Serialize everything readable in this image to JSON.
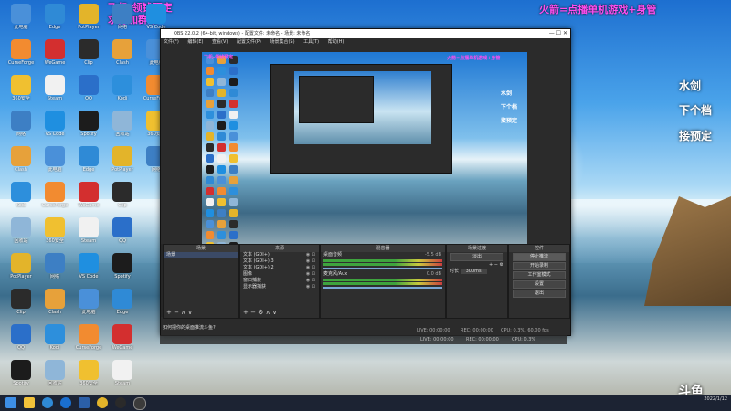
{
  "overlay": {
    "left_line1": "飞机-领钱预定",
    "left_line2": "求打加群账",
    "right": "火箭=点播单机游戏+身管"
  },
  "right_labels": [
    "水剑",
    "下个档",
    "接预定"
  ],
  "watermark": "斗鱼",
  "desktop_icons": [
    {
      "label": "此电脑",
      "color": "#4a90d9"
    },
    {
      "label": "CurseForge",
      "color": "#f28b30"
    },
    {
      "label": "360安全",
      "color": "#f0c030"
    },
    {
      "label": "网络",
      "color": "#3d7fc4"
    },
    {
      "label": "Clash",
      "color": "#e7a13a"
    },
    {
      "label": "Kodi",
      "color": "#2d8fdc"
    },
    {
      "label": "回收站",
      "color": "#8fb6d8"
    },
    {
      "label": "PotPlayer",
      "color": "#e3b42a"
    },
    {
      "label": "Clip",
      "color": "#2b2b2b"
    },
    {
      "label": "QQ",
      "color": "#2b6fc9"
    },
    {
      "label": "Spotify",
      "color": "#1c1c1c"
    },
    {
      "label": "Edge",
      "color": "#2f8ad6"
    },
    {
      "label": "WeGame",
      "color": "#d32f2f"
    },
    {
      "label": "Steam",
      "color": "#f1f1f1"
    },
    {
      "label": "VS Code",
      "color": "#1f8fe0"
    }
  ],
  "obs": {
    "title": "OBS 22.0.2 (64-bit, windows) - 配置文件: 未命名 - 场景: 未命名",
    "menu": [
      "文件(F)",
      "编辑(E)",
      "查看(V)",
      "配置文件(P)",
      "场景集合(S)",
      "工具(T)",
      "帮助(H)"
    ],
    "docks": {
      "scenes": {
        "header": "场景",
        "items": [
          "场景"
        ]
      },
      "sources": {
        "header": "来源",
        "items": [
          "文本 (GDI+)",
          "文本 (GDI+) 3",
          "文本 (GDI+) 2",
          "图像",
          "窗口捕获",
          "显示器捕获"
        ]
      },
      "mixer": {
        "header": "混音器",
        "channels": [
          {
            "name": "桌面音频",
            "value": "-5.5 dB"
          },
          {
            "name": "麦克风/Aux",
            "value": "0.0 dB"
          }
        ]
      },
      "transitions": {
        "header": "场景过渡",
        "type": "淡出",
        "duration_label": "时长",
        "duration": "300ms"
      },
      "controls": {
        "header": "控件",
        "buttons": [
          "停止推流",
          "开始录制",
          "工作室模式",
          "设置",
          "退出"
        ]
      }
    },
    "status": {
      "live": "LIVE: 00:00:00",
      "rec": "REC: 00:00:00",
      "cpu": "CPU: 0.3%, 60.00 fps"
    }
  },
  "bottom_bar": {
    "tooltip": "如何把你的桌面推流斗鱼?",
    "items": [
      "LIVE: 00:00:00",
      "REC: 00:00:00",
      "CPU: 0.3%"
    ]
  },
  "taskbar": {
    "time": "",
    "date": "2022/1/12"
  }
}
